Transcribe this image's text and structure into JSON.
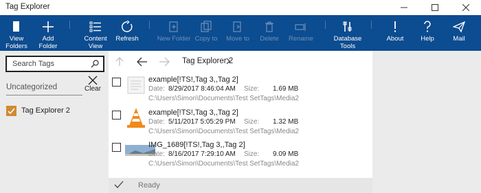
{
  "window": {
    "title": "Tag Explorer"
  },
  "toolbar": {
    "view_folders": "View Folders",
    "add_folder": "Add Folder",
    "content_view_line1": "Content",
    "content_view_line2": "View",
    "refresh": "Refresh",
    "new_folder": "New Folder",
    "copy_to": "Copy to",
    "move_to": "Move to",
    "delete": "Delete",
    "rename": "Rename",
    "database_tools_line1": "Database",
    "database_tools_line2": "Tools",
    "about": "About",
    "help": "Help",
    "mail": "Mail",
    "colors": {
      "background": "#0c4c90",
      "disabled": "#6f91ba"
    }
  },
  "tags": {
    "search_placeholder": "Search Tags",
    "group": "Uncategorized",
    "clear": "Clear",
    "items": [
      {
        "label": "Tag Explorer 2",
        "checked": true
      }
    ]
  },
  "breadcrumb": {
    "current": "Tag Explorer 2"
  },
  "files": [
    {
      "name": "example[!TS!,Tag 3,,Tag 2]",
      "date_label": "Date:",
      "date": "8/29/2017 8:46:04 AM",
      "size_label": "Size:",
      "size": "1.69 MB",
      "path": "C:\\Users\\Simon\\Documents\\Test SetTags\\Media2",
      "thumbnail": "document-icon"
    },
    {
      "name": "example[!TS!,Tag 3,,Tag 2]",
      "date_label": "Date:",
      "date": "5/11/2017 5:05:29 PM",
      "size_label": "Size:",
      "size": "1.32 MB",
      "path": "C:\\Users\\Simon\\Documents\\Test SetTags\\Media2",
      "thumbnail": "vlc-cone-icon"
    },
    {
      "name": "IMG_1689[!TS!,Tag 3,,Tag 2]",
      "date_label": "Date:",
      "date": "8/16/2017 7:29:10 AM",
      "size_label": "Size:",
      "size": "9.09 MB",
      "path": "C:\\Users\\Simon\\Documents\\Test SetTags\\Media2",
      "thumbnail": "photo-thumbnail"
    }
  ],
  "status": {
    "text": "Ready"
  }
}
